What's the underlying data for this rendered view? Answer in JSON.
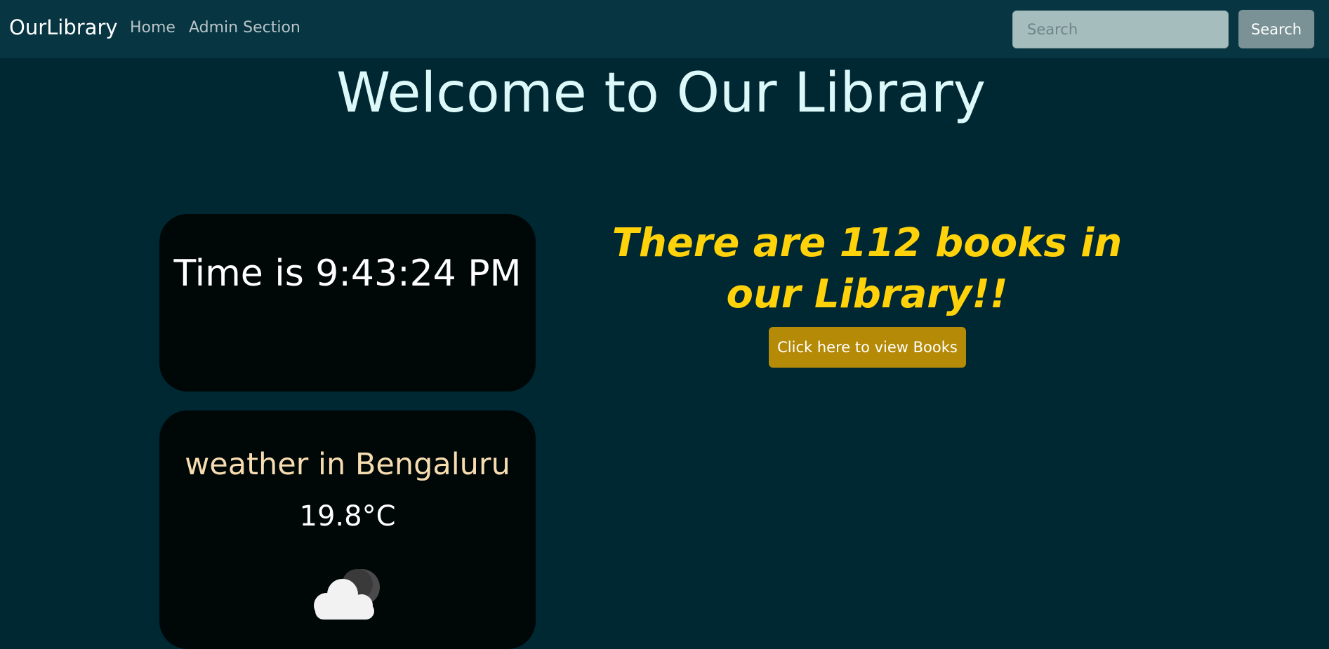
{
  "navbar": {
    "brand": "OurLibrary",
    "links": [
      {
        "label": "Home"
      },
      {
        "label": "Admin Section"
      }
    ],
    "search": {
      "placeholder": "Search",
      "value": "",
      "button_label": "Search"
    }
  },
  "main": {
    "title": "Welcome to Our Library",
    "time_card": {
      "text": "Time is 9:43:24 PM"
    },
    "weather_card": {
      "city_text": "weather in Bengaluru",
      "temperature": "19.8°C",
      "icon": "cloud-moon-icon"
    },
    "books": {
      "heading": "There are 112 books in our Library!!",
      "button_label": "Click here to view Books"
    }
  },
  "colors": {
    "page_background": "#002833",
    "navbar_background": "#073642",
    "card_background": "#000707",
    "accent_yellow": "#ffd20a",
    "button_gold": "#b48a06",
    "city_text": "#f7dcb0"
  }
}
